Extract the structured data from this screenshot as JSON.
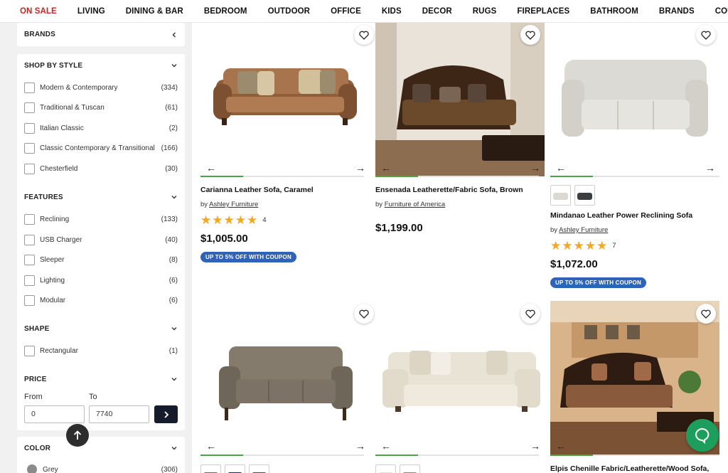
{
  "nav": {
    "items": [
      {
        "label": "ON SALE",
        "sale": true
      },
      {
        "label": "LIVING"
      },
      {
        "label": "DINING & BAR"
      },
      {
        "label": "BEDROOM"
      },
      {
        "label": "OUTDOOR"
      },
      {
        "label": "OFFICE"
      },
      {
        "label": "KIDS"
      },
      {
        "label": "DECOR"
      },
      {
        "label": "RUGS"
      },
      {
        "label": "FIREPLACES"
      },
      {
        "label": "BATHROOM"
      },
      {
        "label": "BRANDS"
      },
      {
        "label": "COUPONS"
      }
    ]
  },
  "filters": {
    "brands": {
      "title": "BRANDS"
    },
    "style": {
      "title": "SHOP BY STYLE",
      "options": [
        {
          "label": "Modern & Contemporary",
          "count": "(334)"
        },
        {
          "label": "Traditional & Tuscan",
          "count": "(61)"
        },
        {
          "label": "Italian Classic",
          "count": "(2)"
        },
        {
          "label": "Classic Contemporary & Transitional",
          "count": "(166)"
        },
        {
          "label": "Chesterfield",
          "count": "(30)"
        }
      ]
    },
    "features": {
      "title": "FEATURES",
      "options": [
        {
          "label": "Reclining",
          "count": "(133)"
        },
        {
          "label": "USB Charger",
          "count": "(40)"
        },
        {
          "label": "Sleeper",
          "count": "(8)"
        },
        {
          "label": "Lighting",
          "count": "(6)"
        },
        {
          "label": "Modular",
          "count": "(6)"
        }
      ]
    },
    "shape": {
      "title": "SHAPE",
      "options": [
        {
          "label": "Rectangular",
          "count": "(1)"
        }
      ]
    },
    "price": {
      "title": "PRICE",
      "from_label": "From",
      "to_label": "To",
      "from_value": "0",
      "to_value": "7740"
    },
    "color": {
      "title": "COLOR",
      "options": [
        {
          "label": "Grey",
          "count": "(306)"
        }
      ]
    }
  },
  "products": [
    {
      "title": "Carianna Leather Sofa, Caramel",
      "by": "by ",
      "brand": "Ashley Furniture",
      "rating": 5,
      "rating_count": "4",
      "price": "$1,005.00",
      "coupon": "UP TO 5% OFF WITH COUPON",
      "colors": {
        "sofa": "#9b6a43"
      }
    },
    {
      "title": "Ensenada Leatherette/Fabric Sofa, Brown",
      "by": "by ",
      "brand": "Furniture of America",
      "price": "$1,199.00",
      "colors": {
        "sofa": "#4a2f1c"
      }
    },
    {
      "title": "Mindanao Leather Power Reclining Sofa",
      "by": "by ",
      "brand": "Ashley Furniture",
      "rating": 5,
      "rating_count": "7",
      "price": "$1,072.00",
      "coupon": "UP TO 5% OFF WITH COUPON",
      "colors": {
        "sofa": "#e4e2dc"
      }
    },
    {
      "colors": {
        "sofa": "#7a7164"
      }
    },
    {
      "colors": {
        "sofa": "#ece6da"
      }
    },
    {
      "title": "Elpis Chenille Fabric/Leatherette/Wood Sofa,",
      "colors": {
        "sofa": "#3a2518"
      }
    }
  ],
  "icons": {
    "heart": "heart-icon",
    "arrow_left": "arrow-left-icon",
    "arrow_right": "arrow-right-icon",
    "chevron": "chevron-down-icon",
    "back_to_top": "arrow-up-icon",
    "chat": "chat-icon"
  },
  "colors": {
    "sale": "#d21f1f",
    "star": "#f5a623",
    "coupon": "#2f63b8",
    "progress": "#4aa24a",
    "chat": "#1e9e5c"
  }
}
